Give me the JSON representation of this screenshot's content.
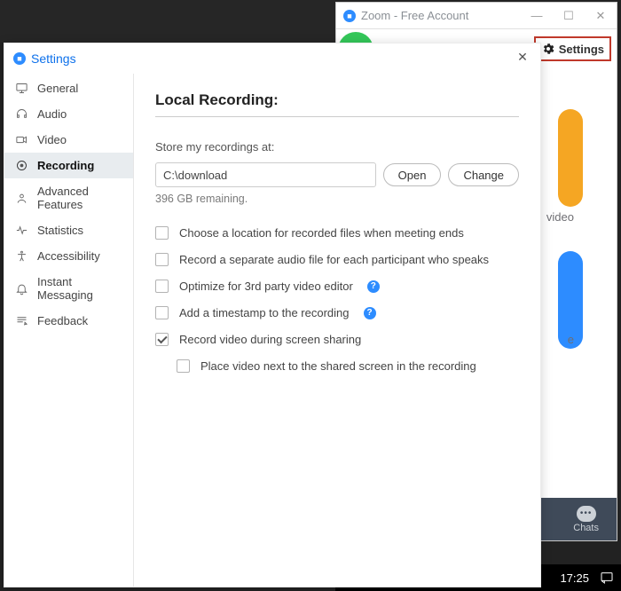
{
  "zoom_window": {
    "title": "Zoom - Free Account",
    "settings_btn": "Settings",
    "peek_video": "video",
    "peek_e": "e",
    "chats_label": "Chats"
  },
  "taskbar": {
    "clock": "17:25"
  },
  "settings": {
    "title": "Settings",
    "sidebar": {
      "items": [
        {
          "label": "General"
        },
        {
          "label": "Audio"
        },
        {
          "label": "Video"
        },
        {
          "label": "Recording"
        },
        {
          "label": "Advanced Features"
        },
        {
          "label": "Statistics"
        },
        {
          "label": "Accessibility"
        },
        {
          "label": "Instant Messaging"
        },
        {
          "label": "Feedback"
        }
      ]
    },
    "content": {
      "heading": "Local Recording:",
      "store_label": "Store my recordings at:",
      "path": "C:\\download",
      "open_btn": "Open",
      "change_btn": "Change",
      "remaining": "396 GB remaining.",
      "options": [
        {
          "label": "Choose a location for recorded files when meeting ends",
          "checked": false
        },
        {
          "label": "Record a separate audio file for each participant who speaks",
          "checked": false
        },
        {
          "label": "Optimize for 3rd party video editor",
          "checked": false,
          "help": true
        },
        {
          "label": "Add a timestamp to the recording",
          "checked": false,
          "help": true
        },
        {
          "label": "Record video during screen sharing",
          "checked": true
        },
        {
          "label": "Place video next to the shared screen in the recording",
          "checked": false,
          "sub": true
        }
      ]
    }
  }
}
